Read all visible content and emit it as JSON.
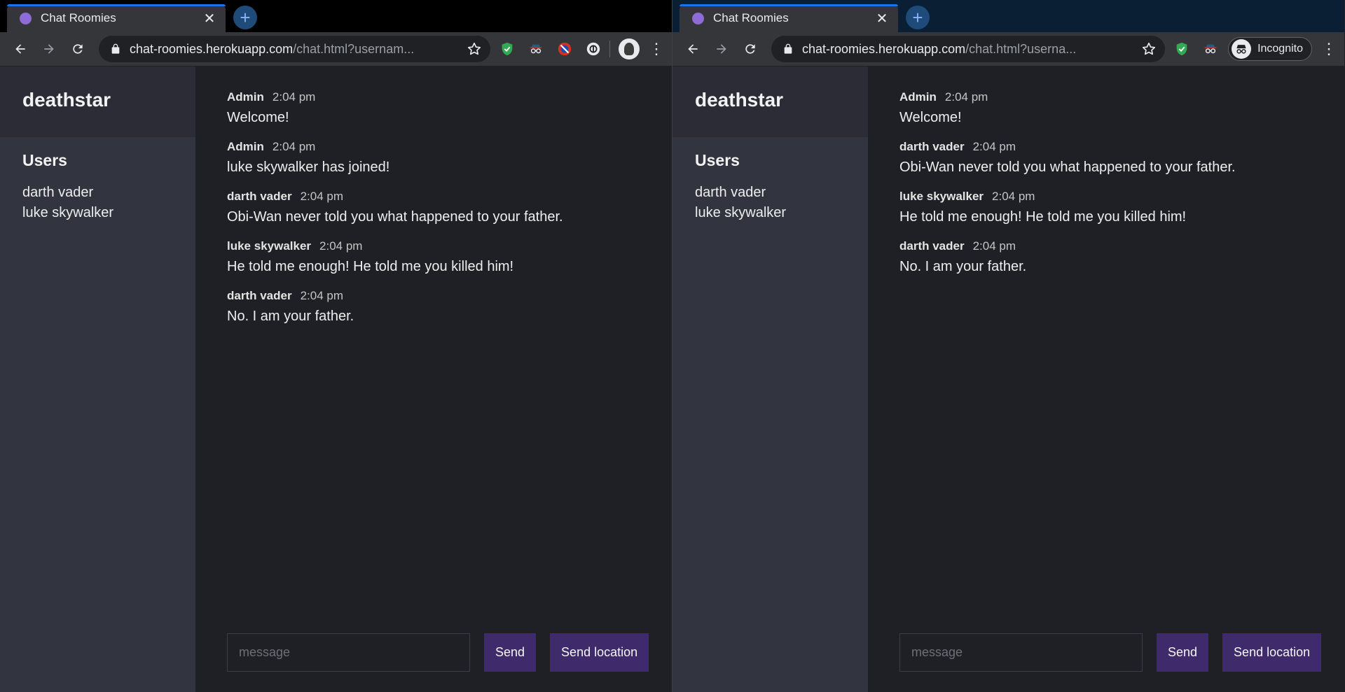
{
  "windows": [
    {
      "tab": {
        "title": "Chat Roomies"
      },
      "address": {
        "host": "chat-roomies.herokuapp.com",
        "path": "/chat.html?usernam..."
      },
      "room": "deathstar",
      "users_heading": "Users",
      "users": [
        "darth vader",
        "luke skywalker"
      ],
      "messages": [
        {
          "name": "Admin",
          "time": "2:04 pm",
          "text": "Welcome!"
        },
        {
          "name": "Admin",
          "time": "2:04 pm",
          "text": "luke skywalker has joined!"
        },
        {
          "name": "darth vader",
          "time": "2:04 pm",
          "text": "Obi-Wan never told you what happened to your father."
        },
        {
          "name": "luke skywalker",
          "time": "2:04 pm",
          "text": "He told me enough! He told me you killed him!"
        },
        {
          "name": "darth vader",
          "time": "2:04 pm",
          "text": "No. I am your father."
        }
      ],
      "composer": {
        "placeholder": "message",
        "send_label": "Send",
        "send_location_label": "Send location"
      },
      "extensions": [
        "shield-extension-icon",
        "spy-extension-icon",
        "blocker-extension-icon",
        "circle-extension-icon"
      ],
      "incognito_label": null
    },
    {
      "tab": {
        "title": "Chat Roomies"
      },
      "address": {
        "host": "chat-roomies.herokuapp.com",
        "path": "/chat.html?userna..."
      },
      "room": "deathstar",
      "users_heading": "Users",
      "users": [
        "darth vader",
        "luke skywalker"
      ],
      "messages": [
        {
          "name": "Admin",
          "time": "2:04 pm",
          "text": "Welcome!"
        },
        {
          "name": "darth vader",
          "time": "2:04 pm",
          "text": "Obi-Wan never told you what happened to your father."
        },
        {
          "name": "luke skywalker",
          "time": "2:04 pm",
          "text": "He told me enough! He told me you killed him!"
        },
        {
          "name": "darth vader",
          "time": "2:04 pm",
          "text": "No. I am your father."
        }
      ],
      "composer": {
        "placeholder": "message",
        "send_label": "Send",
        "send_location_label": "Send location"
      },
      "extensions": [
        "shield-extension-icon",
        "spy-extension-icon"
      ],
      "incognito_label": "Incognito"
    }
  ],
  "colors": {
    "accent_button": "#3f2a6b",
    "sidebar": "#32343f",
    "favicon": "#8e6bd6"
  }
}
